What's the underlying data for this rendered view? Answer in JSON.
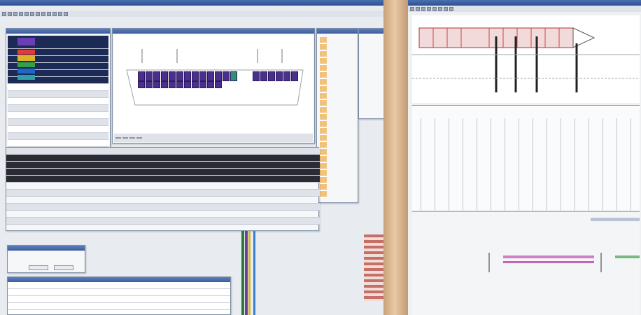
{
  "left_app": {
    "title": "",
    "menu_items": [
      "",
      "",
      "",
      "",
      "",
      "",
      "",
      ""
    ],
    "toolbar_icons": [
      "new-icon",
      "open-icon",
      "save-icon",
      "print-icon",
      "cut-icon",
      "copy-icon",
      "paste-icon",
      "undo-icon",
      "redo-icon",
      "zoom-icon",
      "search-icon",
      "grid-icon"
    ]
  },
  "bay_window": {
    "title": "",
    "tabs": [
      "",
      "",
      "",
      ""
    ],
    "status": ""
  },
  "cargo_list": {
    "colors": [
      "#6a3fb5",
      "#e23b3b",
      "#d9b32a",
      "#35a047",
      "#1f67c7",
      "#2e9fa8",
      "#8e44ad"
    ],
    "rows": 24
  },
  "table_window": {
    "columns": [
      "",
      "",
      "",
      "",
      "",
      "",
      "",
      ""
    ],
    "rows": 12
  },
  "dialog": {
    "title": "",
    "message": "",
    "ok_label": "",
    "cancel_label": ""
  },
  "console": {
    "lines": [
      "",
      "",
      "",
      ""
    ]
  },
  "right_app": {
    "title": "",
    "toolbar_icons": [
      "new-icon",
      "open-icon",
      "save-icon",
      "print-icon",
      "zoom-in-icon",
      "zoom-out-icon",
      "pan-icon",
      "select-icon"
    ],
    "vessel_label": "",
    "timeline_label": ""
  },
  "colors": {
    "accent": "#3a5d9f",
    "bay_cells": "#4b2f8c",
    "bezel": "#c9a27a"
  }
}
